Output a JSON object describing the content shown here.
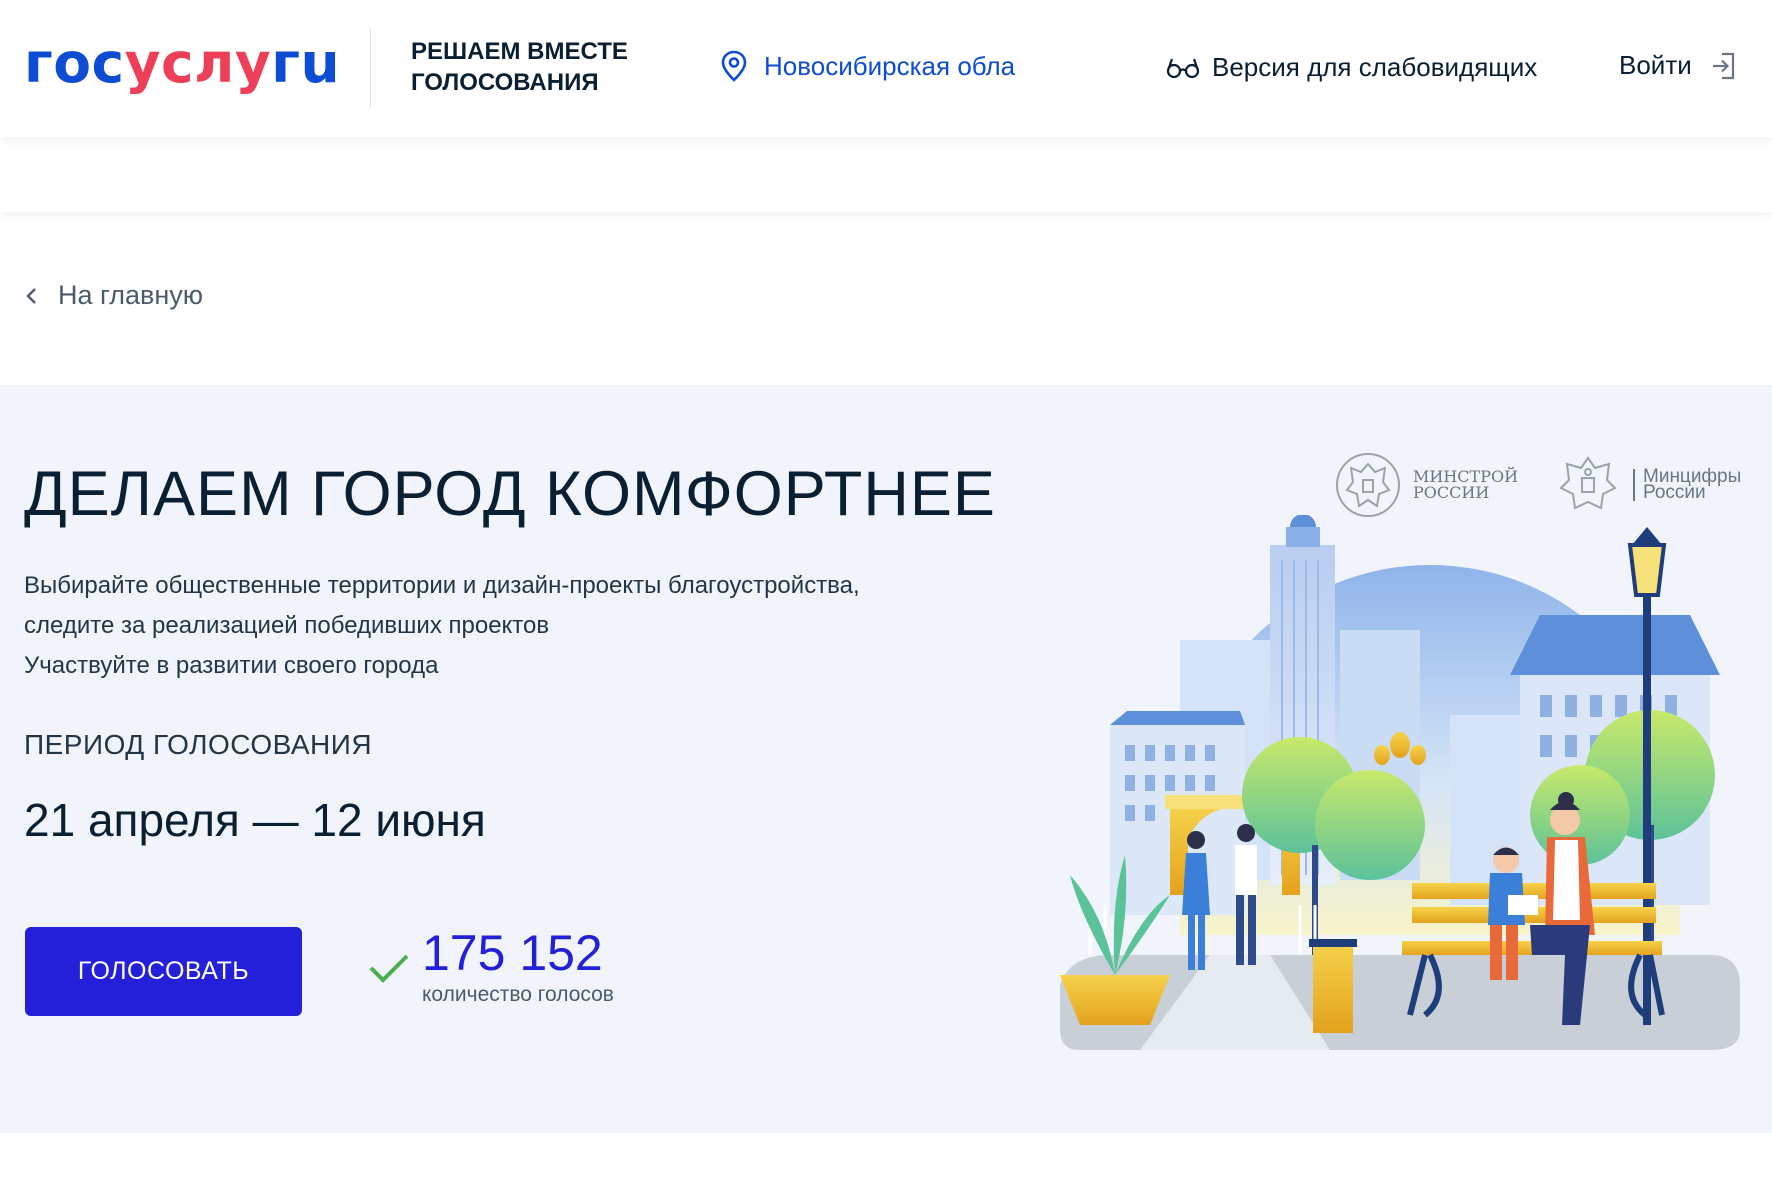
{
  "header": {
    "logo": {
      "part1": "гос",
      "part2": "услу",
      "part3": "гu"
    },
    "project_title": "РЕШАЕМ ВМЕСТЕ ГОЛОСОВАНИЯ",
    "region": "Новосибирская обла",
    "accessibility": "Версия для слабовидящих",
    "login": "Войти"
  },
  "nav": {
    "back": "На главную"
  },
  "hero": {
    "title": "ДЕЛАЕМ ГОРОД КОМФОРТНЕЕ",
    "description": [
      "Выбирайте общественные территории и дизайн-проекты благоустройства,",
      "следите за реализацией победивших проектов",
      "Участвуйте в развитии своего города"
    ],
    "period_label": "ПЕРИОД ГОЛОСОВАНИЯ",
    "period_value": "21 апреля — 12 июня",
    "vote_button": "ГОЛОСОВАТЬ",
    "votes_count": "175 152",
    "votes_caption": "количество голосов"
  },
  "ministries": [
    {
      "line1": "МИНСТРОЙ",
      "line2": "РОССИИ"
    },
    {
      "line1": "Минцифры",
      "line2": "России"
    }
  ],
  "colors": {
    "brand_blue": "#0d4cd3",
    "brand_red": "#ee3f58",
    "button": "#2420d9",
    "hero_bg": "#f1f4fb",
    "check": "#4caf50"
  },
  "icons": {
    "region": "location-pin-icon",
    "accessibility": "glasses-icon",
    "login": "login-arrow-icon",
    "back": "chevron-left-icon",
    "votes": "checkmark-icon"
  }
}
